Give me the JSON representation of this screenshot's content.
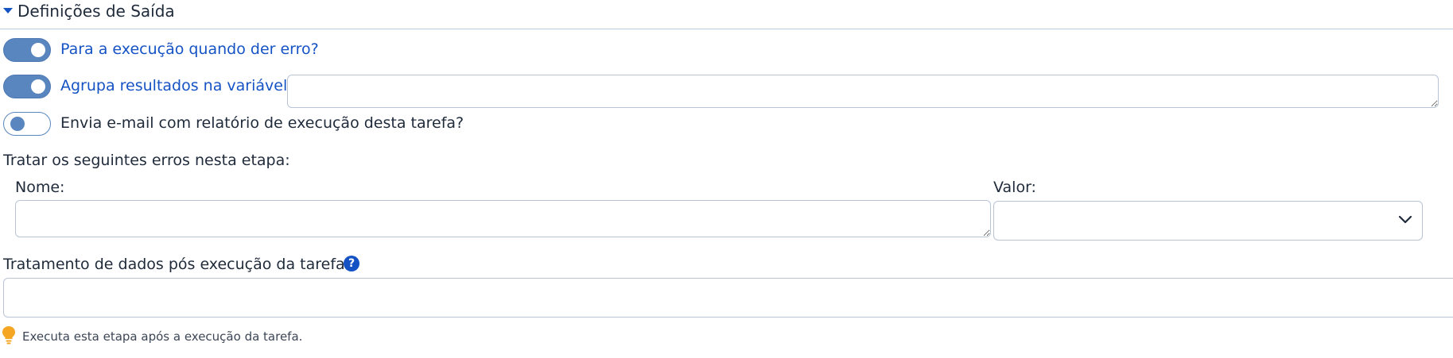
{
  "section": {
    "title": "Definições de Saída"
  },
  "toggles": [
    {
      "label": "Para a execução quando der erro?",
      "state": "on"
    },
    {
      "label": "Agrupa resultados na variável:",
      "state": "on"
    },
    {
      "label": "Envia e-mail com relatório de execução desta tarefa?",
      "state": "off"
    }
  ],
  "group_variable": {
    "value": ""
  },
  "errors_section": {
    "title": "Tratar os seguintes erros nesta etapa:",
    "name_label": "Nome:",
    "value_label": "Valor:",
    "name_value": "",
    "value_selected": ""
  },
  "post_processing": {
    "title": "Tratamento de dados pós execução da tarefa.",
    "help_icon": "question-circle-icon",
    "value": "",
    "hint_icon": "lightbulb-icon",
    "hint": "Executa esta etapa após a execução da tarefa."
  },
  "colors": {
    "accent": "#1553c5",
    "toggle_on": "#5a86c0",
    "border": "#b8c4d6",
    "hint_icon": "#f5a623"
  }
}
